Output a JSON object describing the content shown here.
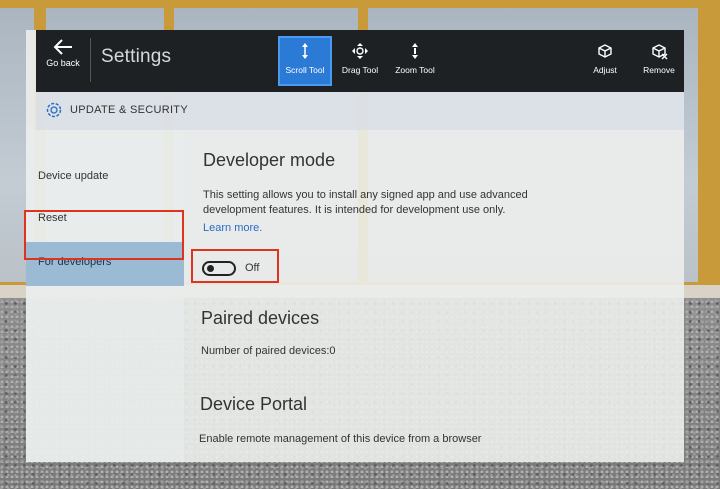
{
  "toolbar": {
    "back_label": "Go back",
    "title": "Settings",
    "tools": [
      {
        "label": "Scroll Tool",
        "icon": "scroll-tool-icon",
        "active": true
      },
      {
        "label": "Drag Tool",
        "icon": "drag-tool-icon",
        "active": false
      },
      {
        "label": "Zoom Tool",
        "icon": "zoom-tool-icon",
        "active": false
      }
    ],
    "right_tools": [
      {
        "label": "Adjust",
        "icon": "adjust-icon"
      },
      {
        "label": "Remove",
        "icon": "remove-icon"
      }
    ]
  },
  "section": {
    "title": "UPDATE & SECURITY",
    "icon": "gear-icon"
  },
  "nav": {
    "items": [
      {
        "label": "Device update",
        "selected": false
      },
      {
        "label": "Reset",
        "selected": false
      },
      {
        "label": "For developers",
        "selected": true
      }
    ]
  },
  "developer_mode": {
    "heading": "Developer mode",
    "description": "This setting allows you to install any signed app and use advanced development features. It is intended for development use only.",
    "link": "Learn more.",
    "toggle_state": "Off"
  },
  "paired_devices": {
    "heading": "Paired devices",
    "count_text": "Number of paired devices:0"
  },
  "device_portal": {
    "heading": "Device Portal",
    "description": "Enable remote management of this device from a browser"
  },
  "colors": {
    "toolbar_bg": "#1d2124",
    "active_tool": "#2a7ad6",
    "selected_nav": "#9bbad3",
    "highlight": "#e0331f",
    "link": "#2b6cc4"
  }
}
